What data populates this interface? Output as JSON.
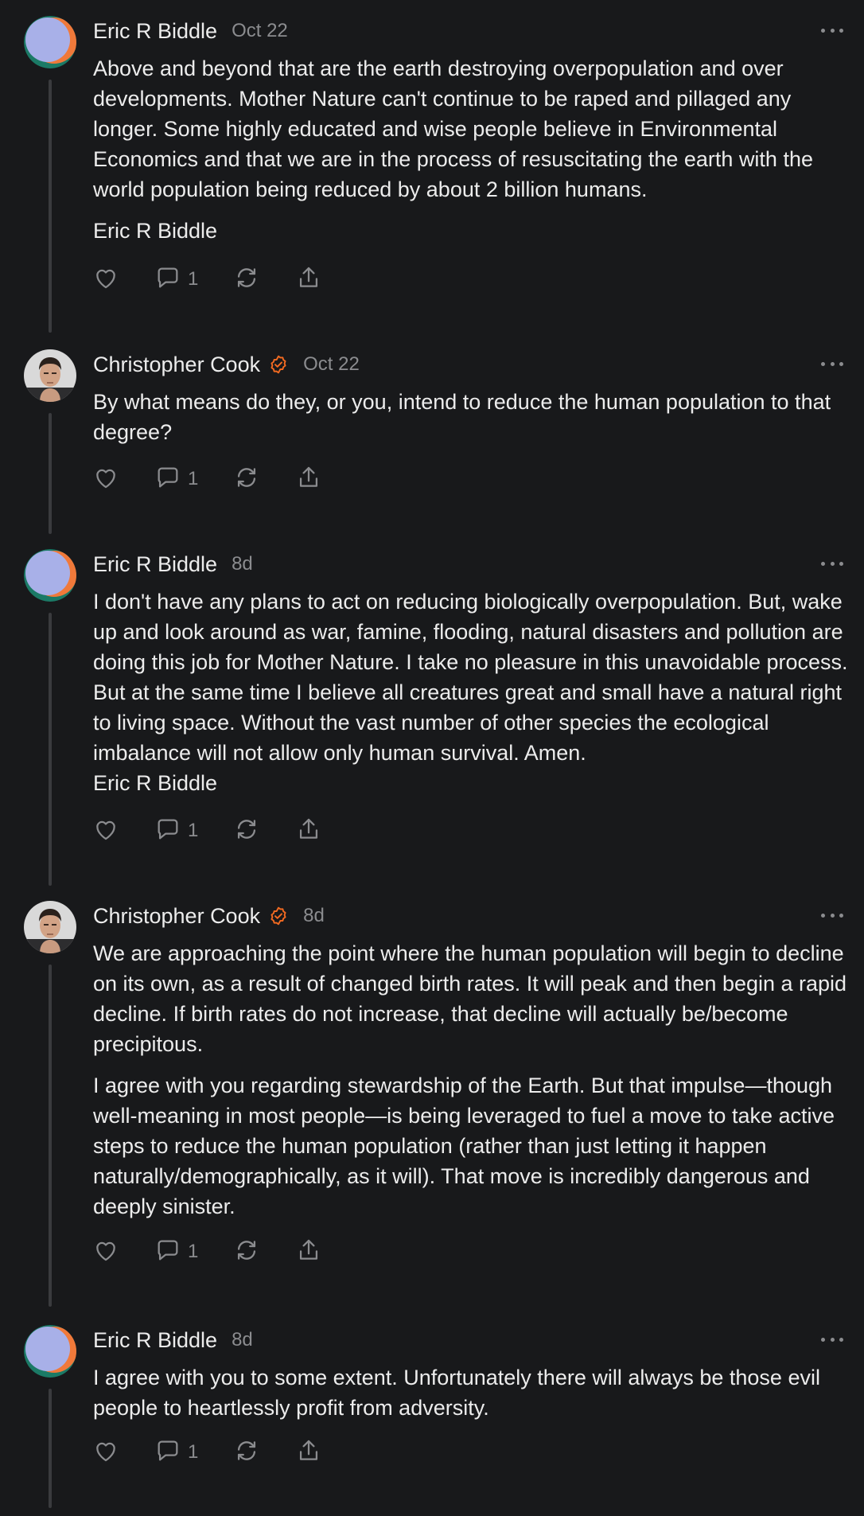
{
  "colors": {
    "background": "#18191b",
    "accent": "#f26a21",
    "muted": "#8b8c8f",
    "text": "#ececec"
  },
  "comments": [
    {
      "author": "Eric R Biddle",
      "verified": false,
      "avatar": "abstract-avatar",
      "date": "Oct 22",
      "paragraphs": [
        "Above and beyond that are the earth destroying overpopulation and over developments. Mother Nature can't continue to be raped and pillaged any longer. Some highly educated and wise people believe in Environmental Economics and that we are in the process of resuscitating the earth with the world population being reduced by about 2 billion humans.",
        "Eric R Biddle"
      ],
      "reply_count": "1"
    },
    {
      "author": "Christopher Cook",
      "verified": true,
      "avatar": "photo-avatar",
      "date": "Oct 22",
      "paragraphs": [
        "By what means do they, or you, intend to reduce the human population to that degree?"
      ],
      "reply_count": "1"
    },
    {
      "author": "Eric R Biddle",
      "verified": false,
      "avatar": "abstract-avatar",
      "date": "8d",
      "paragraphs": [
        "I don't have any plans to act on reducing biologically overpopulation. But, wake up and look around as war, famine, flooding, natural disasters and pollution are doing this job for Mother Nature. I take no pleasure in this unavoidable process. But at the same time I believe all creatures great and small have a natural right to living space. Without the vast number of other species the ecological imbalance will not allow only human survival. Amen.\nEric R Biddle"
      ],
      "reply_count": "1"
    },
    {
      "author": "Christopher Cook",
      "verified": true,
      "avatar": "photo-avatar",
      "date": "8d",
      "paragraphs": [
        "We are approaching the point where the human population will begin to decline on its own, as a result of changed birth rates. It will peak and then begin a rapid decline. If birth rates do not increase, that decline will actually be/become precipitous.",
        "I agree with you regarding stewardship of the Earth. But that impulse—though well-meaning in most people—is being leveraged to fuel a move to take active steps to reduce the human population (rather than just letting it happen naturally/demographically, as it will). That move is incredibly dangerous and deeply sinister."
      ],
      "reply_count": "1"
    },
    {
      "author": "Eric R Biddle",
      "verified": false,
      "avatar": "abstract-avatar",
      "date": "8d",
      "paragraphs": [
        "I agree with you to some extent. Unfortunately there will always be those evil people to heartlessly profit from adversity."
      ],
      "reply_count": "1"
    }
  ]
}
